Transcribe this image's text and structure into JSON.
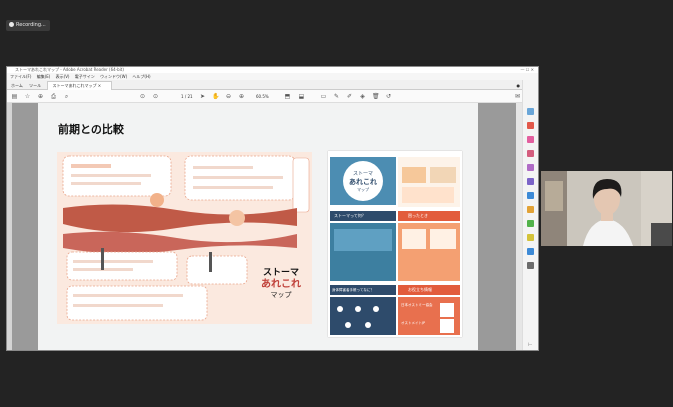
{
  "recording": {
    "label": "Recording..."
  },
  "app": {
    "title": "ストーマあれこれマップ - Adobe Acrobat Reader (64-bit)",
    "menu": [
      "ファイル(F)",
      "編集(E)",
      "表示(V)",
      "電子サイン",
      "ウィンドウ(W)",
      "ヘルプ(H)"
    ],
    "tabs": {
      "home": "ホーム",
      "tools": "ツール",
      "document": "ストーマあれこれマップ"
    },
    "toolbar": {
      "page_current": "1",
      "page_total": "/ 21",
      "zoom": "60.5%"
    }
  },
  "slide": {
    "heading": "前期との比較",
    "left_logo": {
      "line1": "ストーマ",
      "line2": "あれこれ",
      "line3": "マップ"
    },
    "right_poster": {
      "title_line1": "ストーマ",
      "title_line2": "あれこれ",
      "title_line3": "マップ",
      "section1": "ストーマって何？",
      "section2": "困ったとき",
      "section3": "身体障害者手帳ってなに？",
      "section4": "お役立ち情報",
      "link1": "日本オストミー協会",
      "link2": "オストメイトJP"
    }
  },
  "colors": {
    "accent": "#e25c3c",
    "teal": "#3d7fa0",
    "navy": "#2e4b6b",
    "poster_bg": "#fbe9df"
  }
}
